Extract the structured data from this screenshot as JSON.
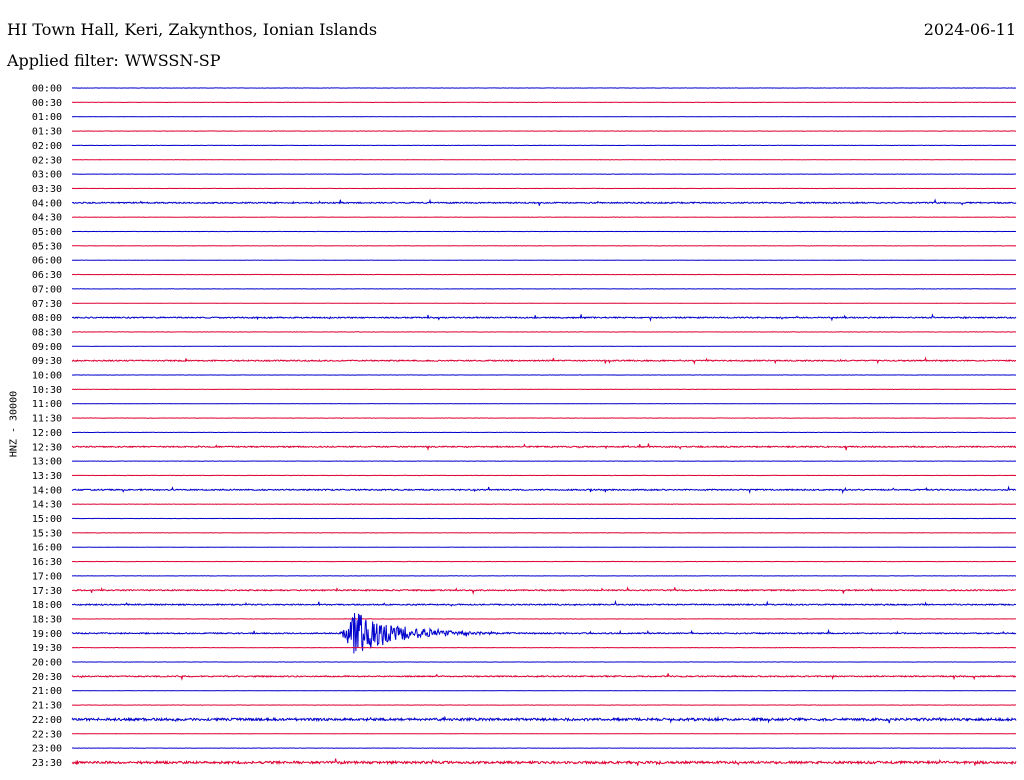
{
  "header": {
    "station": "HI Town Hall, Keri, Zakynthos, Ionian Islands",
    "date": "2024-06-11",
    "filter_label": "Applied filter:",
    "filter_value": "WWSSN-SP"
  },
  "chart_data": {
    "type": "line",
    "title": "HI Town Hall, Keri, Zakynthos, Ionian Islands",
    "ylabel": "HNZ - 30000",
    "row_labels": [
      "00:00",
      "00:30",
      "01:00",
      "01:30",
      "02:00",
      "02:30",
      "03:00",
      "03:30",
      "04:00",
      "04:30",
      "05:00",
      "05:30",
      "06:00",
      "06:30",
      "07:00",
      "07:30",
      "08:00",
      "08:30",
      "09:00",
      "09:30",
      "10:00",
      "10:30",
      "11:00",
      "11:30",
      "12:00",
      "12:30",
      "13:00",
      "13:30",
      "14:00",
      "14:30",
      "15:00",
      "15:30",
      "16:00",
      "16:30",
      "17:00",
      "17:30",
      "18:00",
      "18:30",
      "19:00",
      "19:30",
      "20:00",
      "20:30",
      "21:00",
      "21:30",
      "22:00",
      "22:30",
      "23:00",
      "23:30"
    ],
    "colors": {
      "even": "#0000cc",
      "odd": "#dd0033"
    },
    "events": [
      {
        "row": "19:00",
        "start_min": 8.5,
        "end_min": 18.0,
        "peak_min": 9.0,
        "amplitude": 1.0
      }
    ],
    "activity_rows": [
      "04:00",
      "08:00",
      "09:30",
      "12:30",
      "14:00",
      "17:30",
      "18:00",
      "19:00",
      "20:30",
      "22:00",
      "23:30"
    ]
  }
}
